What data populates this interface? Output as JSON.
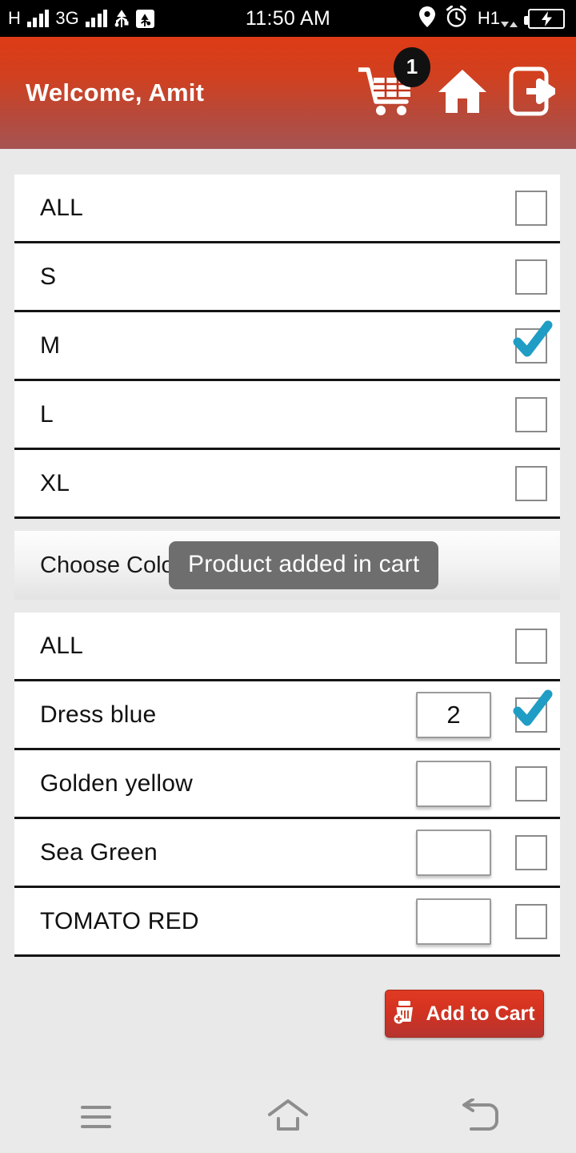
{
  "status_bar": {
    "network_type": "H",
    "network_type_2": "3G",
    "time": "11:50 AM",
    "data_indicator": "H1",
    "icons": [
      "signal-bars",
      "signal-bars",
      "usb-icon",
      "usb-debugging-icon",
      "location-pin-icon",
      "alarm-clock-icon",
      "h1-data-icon",
      "battery-charging-icon"
    ]
  },
  "header": {
    "title": "Welcome, Amit",
    "cart_badge_count": "1",
    "actions": [
      "cart-icon",
      "home-icon",
      "logout-icon"
    ],
    "gradient_top": "#de3b16",
    "gradient_bottom": "#a75453"
  },
  "sizes": {
    "rows": [
      {
        "label": "ALL",
        "checked": false
      },
      {
        "label": "S",
        "checked": false
      },
      {
        "label": "M",
        "checked": true
      },
      {
        "label": "L",
        "checked": false
      },
      {
        "label": "XL",
        "checked": false
      }
    ]
  },
  "colors_section": {
    "header": "Choose Colors",
    "rows": [
      {
        "label": "ALL",
        "qty": "",
        "has_qty": false,
        "checked": false
      },
      {
        "label": "Dress blue",
        "qty": "2",
        "has_qty": true,
        "checked": true
      },
      {
        "label": "Golden yellow",
        "qty": "",
        "has_qty": true,
        "checked": false
      },
      {
        "label": "Sea Green",
        "qty": "",
        "has_qty": true,
        "checked": false
      },
      {
        "label": "TOMATO RED",
        "qty": "",
        "has_qty": true,
        "checked": false
      }
    ]
  },
  "toast": {
    "message": "Product added in cart"
  },
  "add_to_cart": {
    "label": "Add to Cart",
    "color": "#d23221"
  },
  "navbar": {
    "buttons": [
      "menu-icon",
      "home-outline-icon",
      "back-icon"
    ],
    "icon_color": "#8d8d8d"
  },
  "theme": {
    "accent": "#d23221",
    "check_color": "#1f9dc4",
    "page_bg": "#e9e9e9"
  }
}
